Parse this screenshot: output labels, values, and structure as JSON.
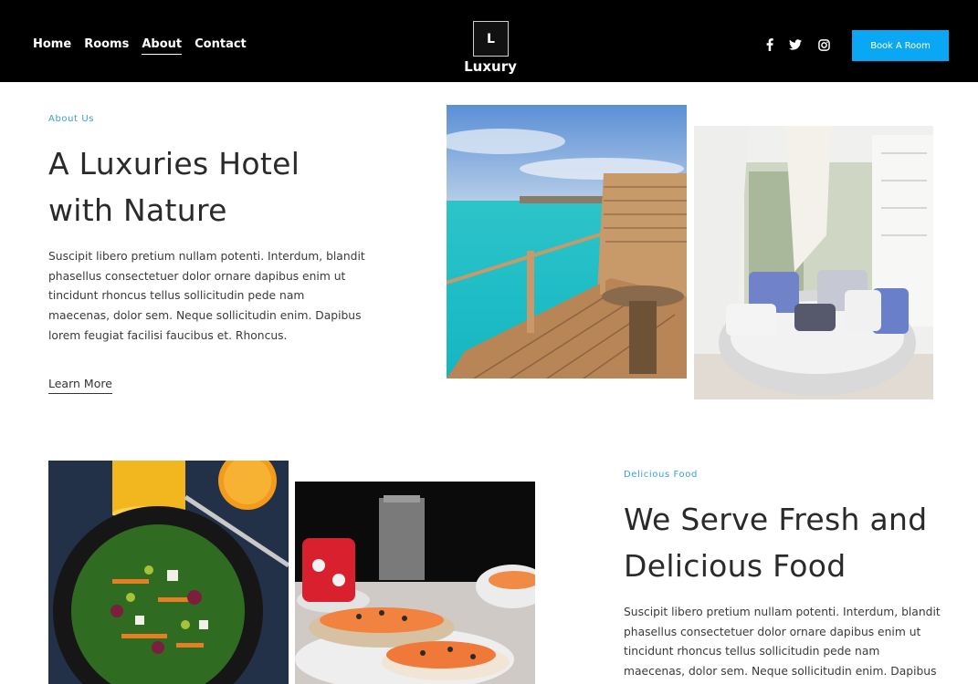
{
  "nav": {
    "items": [
      "Home",
      "Rooms",
      "About",
      "Contact"
    ],
    "active": "About"
  },
  "brand": {
    "mark": "L",
    "name": "Luxury"
  },
  "social": [
    "facebook-icon",
    "twitter-icon",
    "instagram-icon"
  ],
  "cta": {
    "label": "Book A Room"
  },
  "about": {
    "eyebrow": "About Us",
    "title_line1": "A Luxuries Hotel",
    "title_line2": "with Nature",
    "body_lines": [
      "Suscipit libero pretium nullam potenti. Interdum, blandit",
      "phasellus consectetuer dolor ornare dapibus enim ut",
      "tincidunt rhoncus tellus sollicitudin pede nam",
      "maecenas, dolor sem. Neque sollicitudin enim. Dapibus",
      "lorem feugiat facilisi faucibus et. Rhoncus."
    ],
    "link": "Learn More"
  },
  "food": {
    "eyebrow": "Delicious Food",
    "title_line1": "We Serve Fresh and",
    "title_line2": "Delicious Food",
    "body_lines": [
      "Suscipit libero pretium nullam potenti. Interdum, blandit",
      "phasellus consectetuer dolor ornare dapibus enim ut",
      "tincidunt rhoncus tellus sollicitudin pede nam",
      "maecenas, dolor sem. Neque sollicitudin enim. Dapibus"
    ]
  },
  "colors": {
    "accent": "#0aa7f5",
    "eyebrow": "#3a9ed8",
    "header": "#000000"
  }
}
